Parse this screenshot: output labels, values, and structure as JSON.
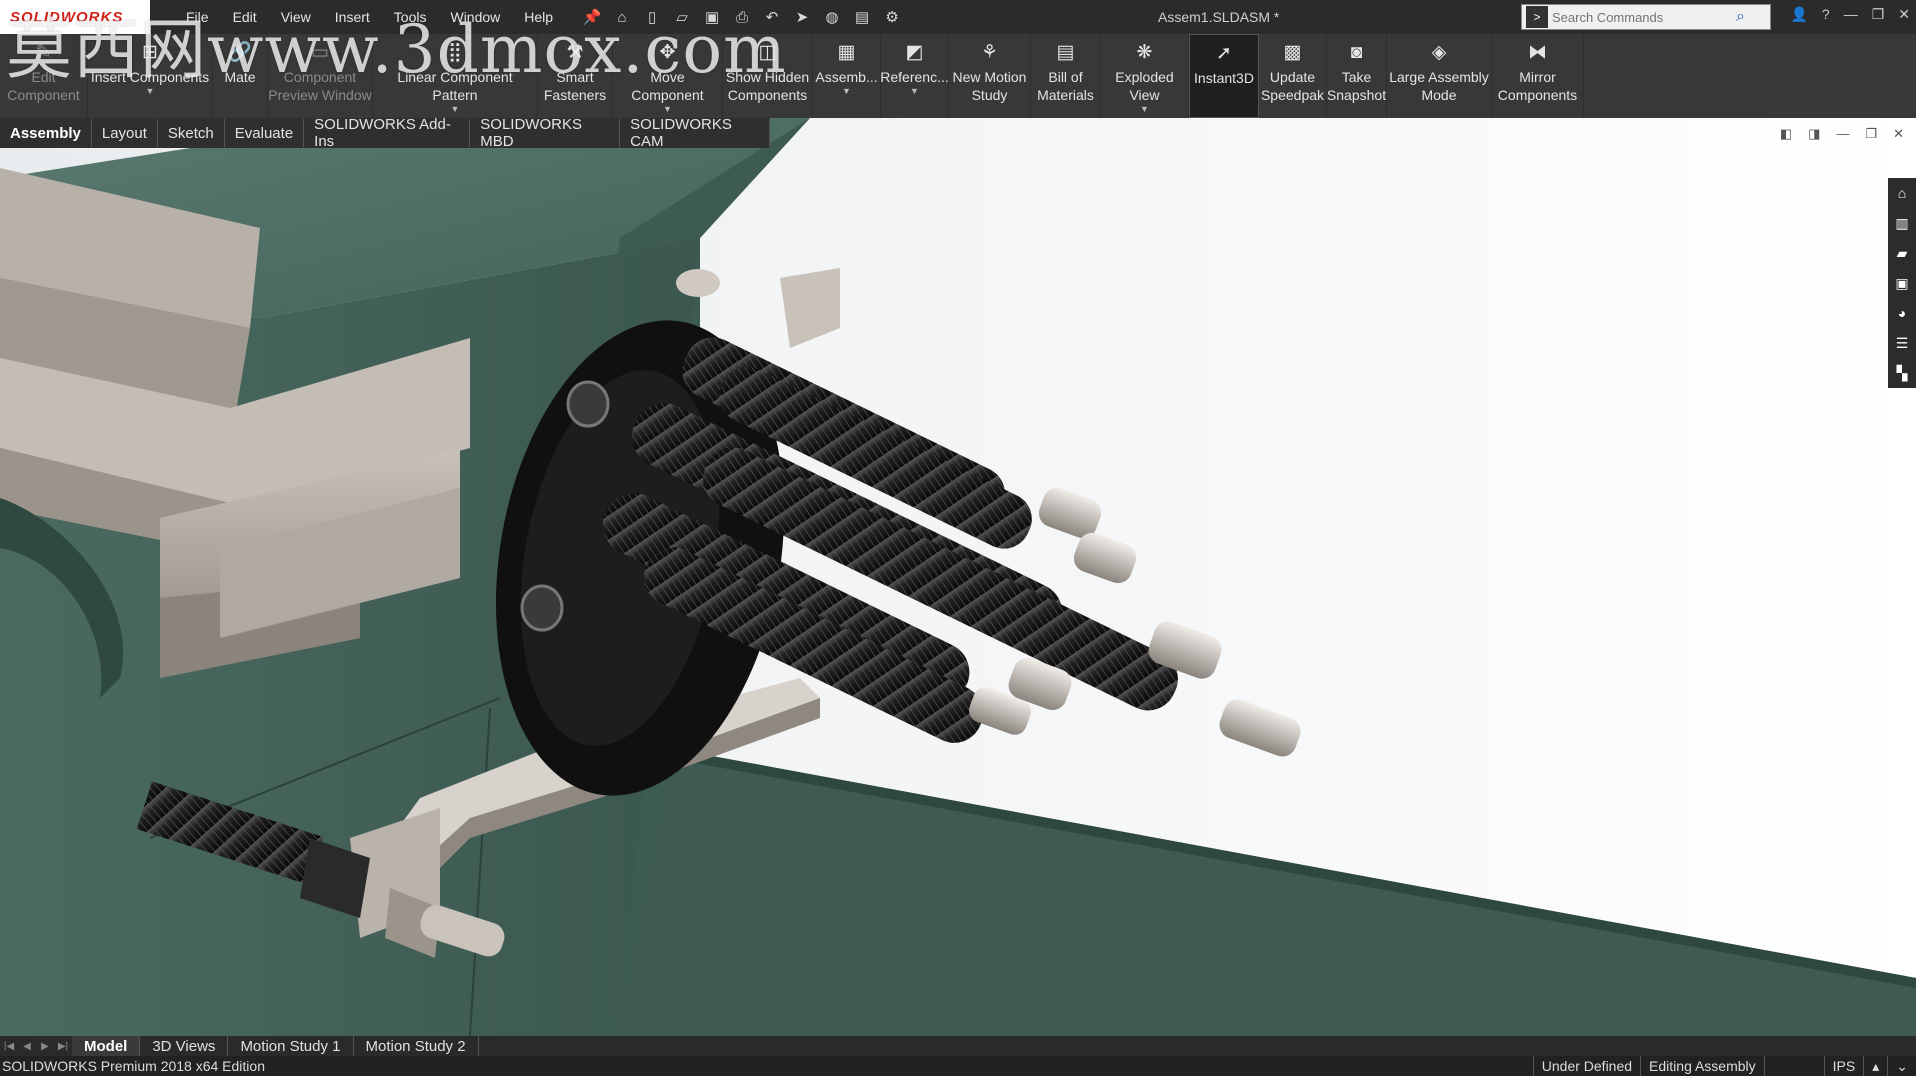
{
  "app": {
    "logo_text": "SOLIDWORKS",
    "doc_title": "Assem1.SLDASM *"
  },
  "menu": {
    "items": [
      "File",
      "Edit",
      "View",
      "Insert",
      "Tools",
      "Window",
      "Help"
    ]
  },
  "search": {
    "placeholder": "Search Commands"
  },
  "ribbon": {
    "edit_component": "Edit Component",
    "insert_components": "Insert Components",
    "mate": "Mate",
    "component_preview": "Component Preview Window",
    "linear_pattern": "Linear Component Pattern",
    "smart_fasteners": "Smart Fasteners",
    "move_component": "Move Component",
    "show_hidden": "Show Hidden Components",
    "assembly_features": "Assemb...",
    "reference_geometry": "Referenc...",
    "new_motion_study": "New Motion Study",
    "bill_of_materials": "Bill of Materials",
    "exploded_view": "Exploded View",
    "instant3d": "Instant3D",
    "update_speedpak": "Update Speedpak",
    "take_snapshot": "Take Snapshot",
    "large_assembly_mode": "Large Assembly Mode",
    "mirror_components": "Mirror Components"
  },
  "command_tabs": [
    "Assembly",
    "Layout",
    "Sketch",
    "Evaluate",
    "SOLIDWORKS Add-Ins",
    "SOLIDWORKS MBD",
    "SOLIDWORKS CAM"
  ],
  "bottom_tabs": [
    "Model",
    "3D Views",
    "Motion Study 1",
    "Motion Study 2"
  ],
  "status": {
    "edition": "SOLIDWORKS Premium 2018 x64 Edition",
    "definition": "Under Defined",
    "mode": "Editing Assembly",
    "units": "IPS"
  },
  "watermark": "莫西网www.3dmox.com",
  "colors": {
    "vise_green": "#4f6f66",
    "metal_gray": "#b5aea6",
    "black_part": "#141414",
    "accent_red": "#d0241b"
  }
}
